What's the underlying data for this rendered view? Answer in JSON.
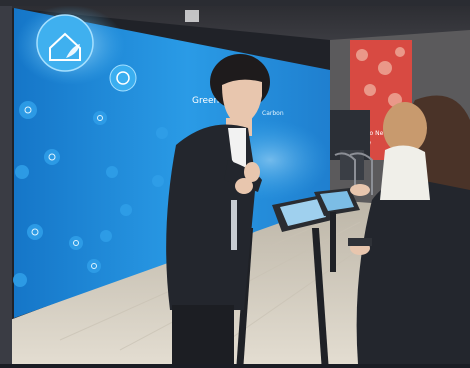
{
  "scene": {
    "wall_caption": "Green",
    "wall_subcaption": "Carbon",
    "backdrop_panel_text": "Hello\nNew\nNow"
  },
  "colors": {
    "wall_blue": "#1a86d8",
    "wall_light": "#46b4f0",
    "panel_red": "#d84a42",
    "suit_dark": "#23262d",
    "floor": "#d8d2c6"
  },
  "icons": [
    "house-leaf-icon",
    "recycle-icon",
    "leaf-icon",
    "droplet-icon",
    "globe-icon"
  ]
}
